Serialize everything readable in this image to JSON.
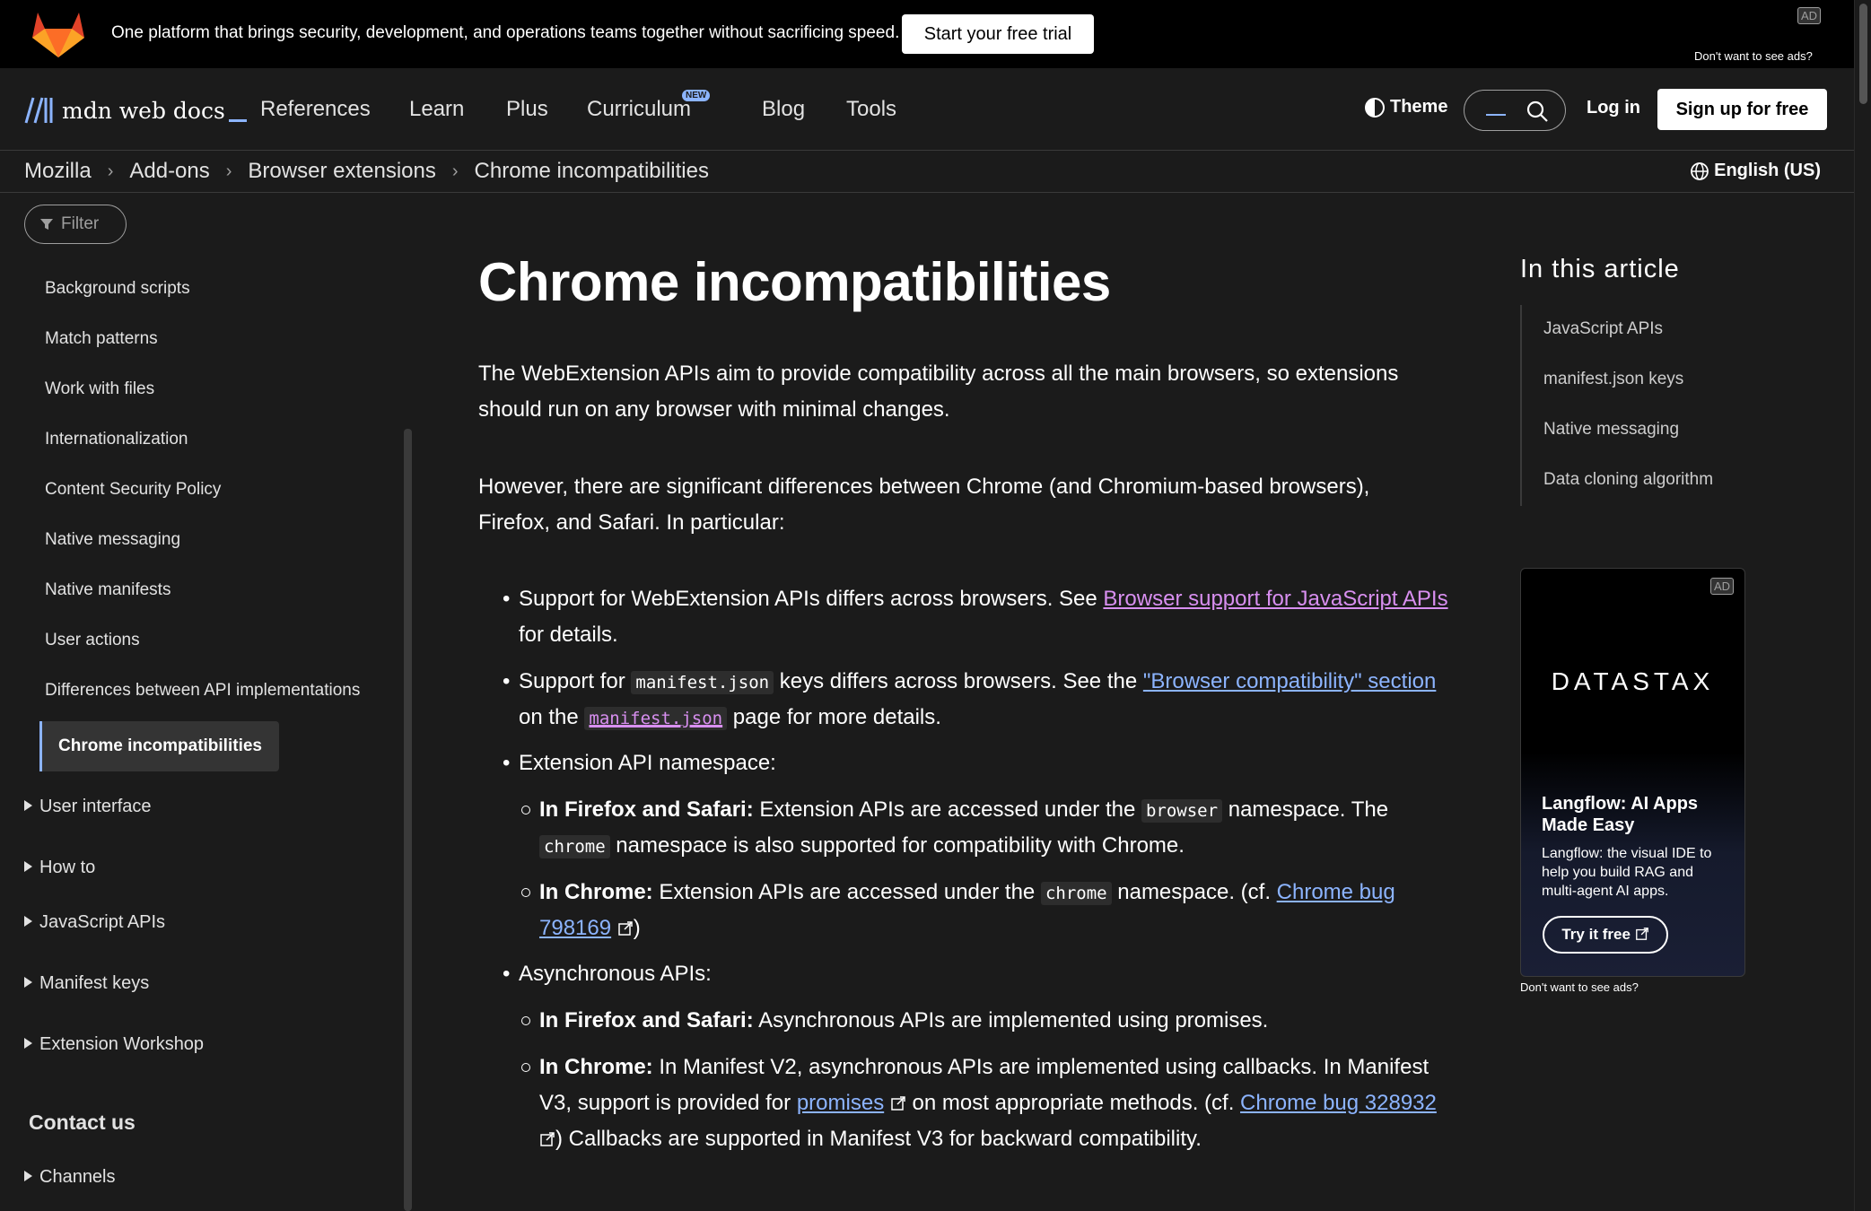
{
  "top_ad": {
    "message": "One platform that brings security, development, and operations teams together without sacrificing speed.",
    "cta": "Start your free trial",
    "badge": "AD",
    "no_ads": "Don't want to see ads?"
  },
  "header": {
    "logo_text": "mdn web docs",
    "nav": [
      "References",
      "Learn",
      "Plus",
      "Curriculum",
      "Blog",
      "Tools"
    ],
    "new_badge": "NEW",
    "theme": "Theme",
    "login": "Log in",
    "signup": "Sign up for free"
  },
  "breadcrumb": [
    "Mozilla",
    "Add-ons",
    "Browser extensions",
    "Chrome incompatibilities"
  ],
  "language": "English (US)",
  "sidebar": {
    "filter_placeholder": "Filter",
    "items": [
      "Background scripts",
      "Match patterns",
      "Work with files",
      "Internationalization",
      "Content Security Policy",
      "Native messaging",
      "Native manifests",
      "User actions",
      "Differences between API implementations"
    ],
    "active": "Chrome incompatibilities",
    "groups": [
      "User interface",
      "How to",
      "JavaScript APIs",
      "Manifest keys",
      "Extension Workshop"
    ],
    "contact": "Contact us",
    "channels": "Channels"
  },
  "article": {
    "title": "Chrome incompatibilities",
    "p1": "The WebExtension APIs aim to provide compatibility across all the main browsers, so extensions should run on any browser with minimal changes.",
    "p2": "However, there are significant differences between Chrome (and Chromium-based browsers), Firefox, and Safari. In particular:",
    "b1_pre": "Support for WebExtension APIs differs across browsers. See ",
    "b1_link": "Browser support for JavaScript APIs",
    "b1_post": "for details.",
    "b2_pre": "Support for ",
    "b2_code": "manifest.json",
    "b2_mid": " keys differs across browsers. See the ",
    "b2_link": "\"Browser compatibility\" section",
    "b2_on": "on the ",
    "b2_link2": "manifest.json",
    "b2_post": " page for more details.",
    "b3": "Extension API namespace:",
    "s1_bold": "In Firefox and Safari:",
    "s1_text": " Extension APIs are accessed under the ",
    "s1_code": "browser",
    "s1_text2": " namespace. The",
    "s1_code2": "chrome",
    "s1_text3": " namespace is also supported for compatibility with Chrome.",
    "s2_bold": "In Chrome:",
    "s2_text": " Extension APIs are accessed under the ",
    "s2_code": "chrome",
    "s2_text2": " namespace. (cf. ",
    "s2_link": "Chrome bug",
    "s2_link2": "798169",
    "s2_close": ")",
    "b4": "Asynchronous APIs:",
    "s3_bold": "In Firefox and Safari:",
    "s3_text": " Asynchronous APIs are implemented using promises.",
    "s4_bold": "In Chrome:",
    "s4_text": " In Manifest V2, asynchronous APIs are implemented using callbacks. In Manifest",
    "s4_text2": "V3, support is provided for ",
    "s4_link": "promises",
    "s4_text3": " on most appropriate methods. (cf. ",
    "s4_link2": "Chrome bug 328932",
    "s4_text4": ") Callbacks are supported in Manifest V3 for backward compatibility."
  },
  "toc": {
    "title": "In this article",
    "items": [
      "JavaScript APIs",
      "manifest.json keys",
      "Native messaging",
      "Data cloning algorithm"
    ]
  },
  "side_ad": {
    "badge": "AD",
    "brand": "DATASTAX",
    "title": "Langflow: AI Apps Made Easy",
    "desc": "Langflow: the visual IDE to help you build RAG and multi-agent AI apps.",
    "cta": "Try it free",
    "no_ads": "Don't want to see ads?"
  }
}
